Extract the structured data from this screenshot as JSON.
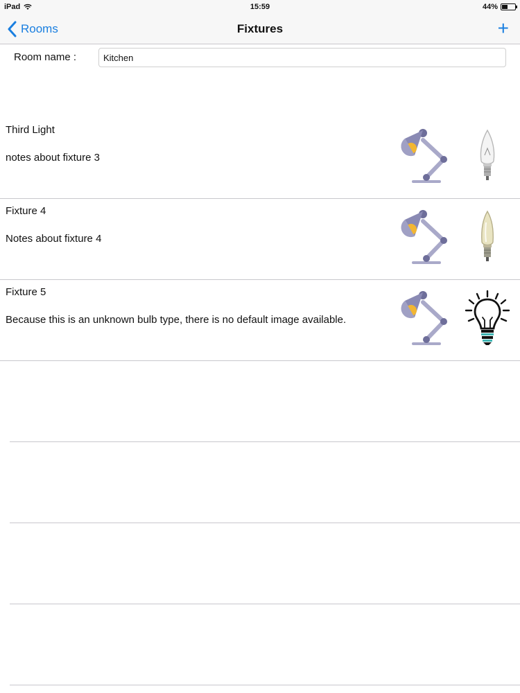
{
  "status_bar": {
    "device": "iPad",
    "time": "15:59",
    "battery_text": "44%",
    "battery_level": 0.44
  },
  "nav": {
    "back_label": "Rooms",
    "title": "Fixtures",
    "add_label": "+",
    "accent_color": "#1a7fe0"
  },
  "room": {
    "label": "Room name :",
    "value": "Kitchen"
  },
  "fixtures": [
    {
      "name": "Third Light",
      "notes": "notes about fixture 3",
      "lamp_icon": "desk-lamp-icon",
      "bulb_icon": "clear-candle-bulb-icon"
    },
    {
      "name": "Fixture 4",
      "notes": "Notes about fixture 4",
      "lamp_icon": "desk-lamp-icon",
      "bulb_icon": "amber-candle-bulb-icon"
    },
    {
      "name": "Fixture 5",
      "notes": "Because this is an unknown bulb type, there is no default image available.",
      "lamp_icon": "desk-lamp-icon",
      "bulb_icon": "generic-lightbulb-icon"
    }
  ]
}
